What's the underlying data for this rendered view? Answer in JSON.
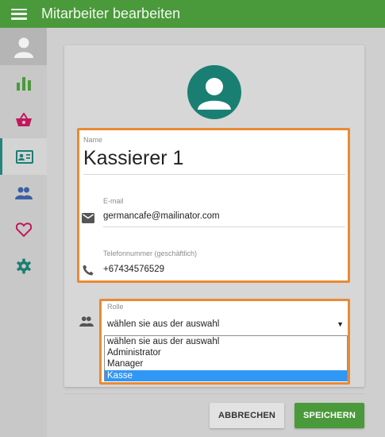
{
  "header": {
    "title": "Mitarbeiter bearbeiten"
  },
  "sidebar": {
    "items": [
      {
        "name": "chart-icon",
        "color": "#4a9a3b"
      },
      {
        "name": "basket-icon",
        "color": "#c2185b"
      },
      {
        "name": "id-card-icon",
        "color": "#1a7f73",
        "active": true
      },
      {
        "name": "people-icon",
        "color": "#3e5fa3"
      },
      {
        "name": "heart-icon",
        "color": "#c2185b"
      },
      {
        "name": "gear-icon",
        "color": "#1a7f73"
      }
    ]
  },
  "form": {
    "name_label": "Name",
    "name_value": "Kassierer 1",
    "email_label": "E-mail",
    "email_value": "germancafe@mailinator.com",
    "phone_label": "Telefonnummer (geschäftlich)",
    "phone_value": "+67434576529"
  },
  "role": {
    "label": "Rolle",
    "selected": "wählen sie aus der auswahl",
    "options": [
      "wählen sie aus der auswahl",
      "Administrator",
      "Manager",
      "Kasse"
    ],
    "highlighted_option": "Kasse"
  },
  "actions": {
    "cancel_label": "ABBRECHEN",
    "save_label": "SPEICHERN"
  },
  "colors": {
    "primary": "#4a9a3b",
    "teal": "#1a7f73",
    "highlight": "#e98a34",
    "selection": "#3197f5"
  }
}
